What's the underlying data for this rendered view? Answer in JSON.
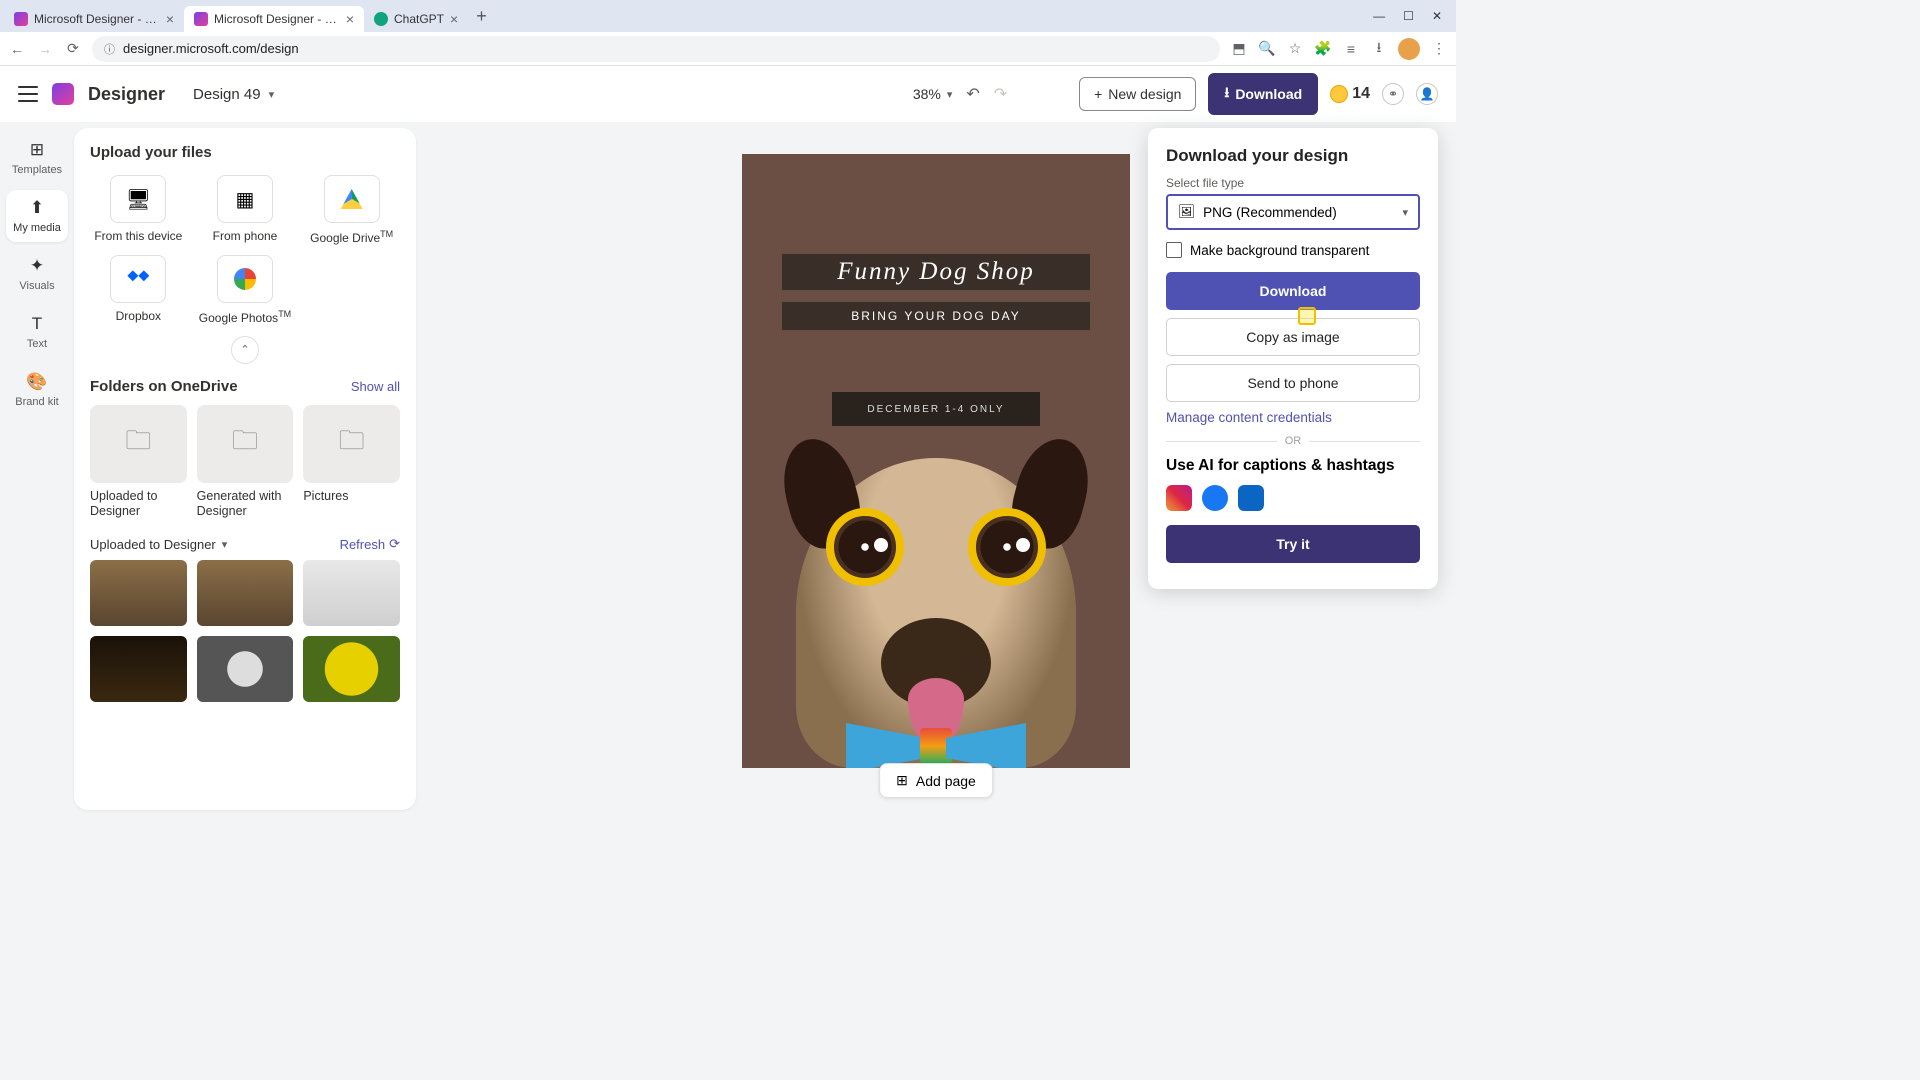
{
  "browser": {
    "tabs": [
      {
        "title": "Microsoft Designer - Stunning"
      },
      {
        "title": "Microsoft Designer - Stunning"
      },
      {
        "title": "ChatGPT"
      }
    ],
    "url": "designer.microsoft.com/design"
  },
  "header": {
    "brand": "Designer",
    "design_name": "Design 49",
    "zoom": "38%",
    "new_design": "New design",
    "download": "Download",
    "coins": "14"
  },
  "rail": {
    "templates": "Templates",
    "my_media": "My media",
    "visuals": "Visuals",
    "text": "Text",
    "brand_kit": "Brand kit"
  },
  "panel": {
    "upload_title": "Upload your files",
    "sources": {
      "device": "From this device",
      "phone": "From phone",
      "gdrive": "Google Drive™",
      "dropbox": "Dropbox",
      "gphotos": "Google Photos™"
    },
    "folders_title": "Folders on OneDrive",
    "show_all": "Show all",
    "folders": {
      "uploaded": "Uploaded to Designer",
      "generated": "Generated with Designer",
      "pictures": "Pictures"
    },
    "uploaded_section": "Uploaded to Designer",
    "refresh": "Refresh"
  },
  "artboard": {
    "title": "Funny Dog Shop",
    "subtitle": "BRING YOUR DOG DAY",
    "dates": "DECEMBER 1-4 ONLY"
  },
  "add_page": "Add page",
  "popover": {
    "title": "Download your design",
    "file_type_label": "Select file type",
    "file_type_value": "PNG (Recommended)",
    "transparent": "Make background transparent",
    "download": "Download",
    "copy": "Copy as image",
    "send": "Send to phone",
    "manage": "Manage content credentials",
    "or": "OR",
    "ai_title": "Use AI for captions & hashtags",
    "try": "Try it"
  }
}
